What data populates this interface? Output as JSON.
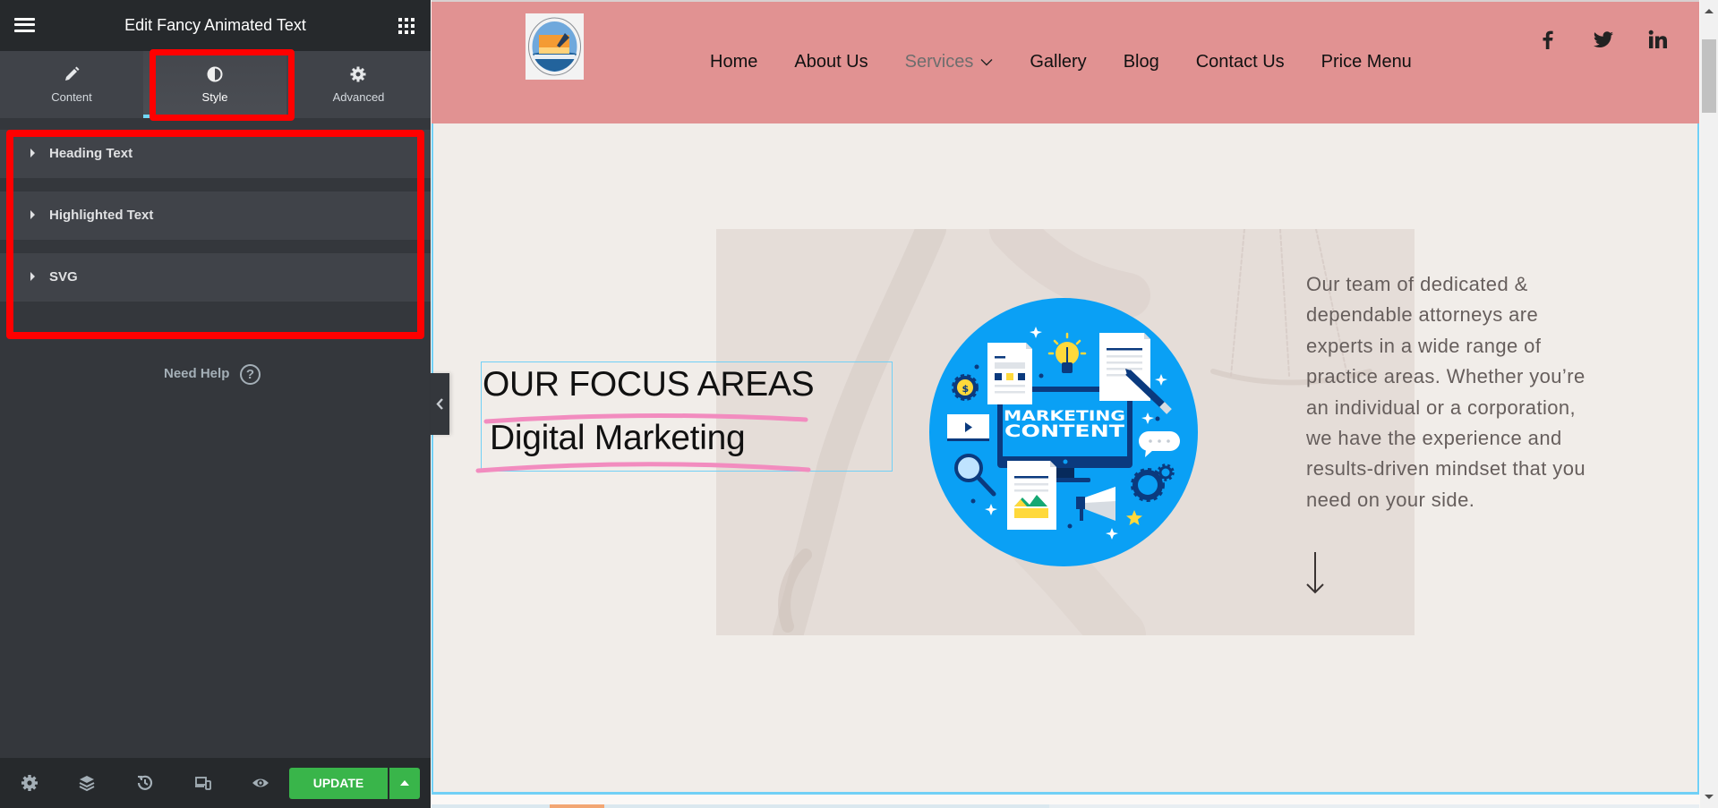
{
  "editor_panel": {
    "title": "Edit Fancy Animated Text",
    "menu_icon": "hamburger-icon",
    "apps_icon": "grid-icon",
    "tabs": [
      {
        "label": "Content",
        "icon": "pencil-icon",
        "active": false
      },
      {
        "label": "Style",
        "icon": "contrast-icon",
        "active": true
      },
      {
        "label": "Advanced",
        "icon": "gear-icon",
        "active": false
      }
    ],
    "sections": [
      {
        "label": "Heading Text",
        "expanded": false
      },
      {
        "label": "Highlighted Text",
        "expanded": false
      },
      {
        "label": "SVG",
        "expanded": false
      }
    ],
    "help": {
      "label": "Need Help",
      "icon_glyph": "?"
    },
    "footer": {
      "icons": [
        "settings-icon",
        "navigator-layers-icon",
        "history-icon",
        "responsive-mode-icon",
        "preview-eye-icon"
      ],
      "update_label": "UPDATE",
      "update_options_icon": "caret-up-icon"
    }
  },
  "site_header": {
    "nav": [
      {
        "label": "Home"
      },
      {
        "label": "About Us"
      },
      {
        "label": "Services",
        "has_dropdown": true,
        "active": true
      },
      {
        "label": "Gallery"
      },
      {
        "label": "Blog"
      },
      {
        "label": "Contact Us"
      },
      {
        "label": "Price Menu"
      }
    ],
    "social": [
      "facebook-icon",
      "twitter-icon",
      "linkedin-icon"
    ]
  },
  "content": {
    "heading": "OUR FOCUS AREAS",
    "highlighted_text": "Digital Marketing",
    "illustration": {
      "line1": "MARKETING",
      "line2": "CONTENT"
    },
    "paragraph_lines": [
      "Our team of dedicated &",
      "dependable attorneys are",
      "experts in a wide range of",
      "practice areas. Whether you’re",
      "an individual or a corporation,",
      "we have the experience and",
      "results-driven mindset that you",
      "need on your side."
    ],
    "scroll_icon": "arrow-down-icon"
  },
  "colors": {
    "header_bg": "#e19292",
    "panel_bg": "#34373c",
    "update_green": "#39b54a",
    "highlight_pink": "#f28cbf",
    "annotation_red": "#ff0000",
    "selection_blue": "#71d0f6",
    "illustration_blue": "#0aa0f5"
  }
}
